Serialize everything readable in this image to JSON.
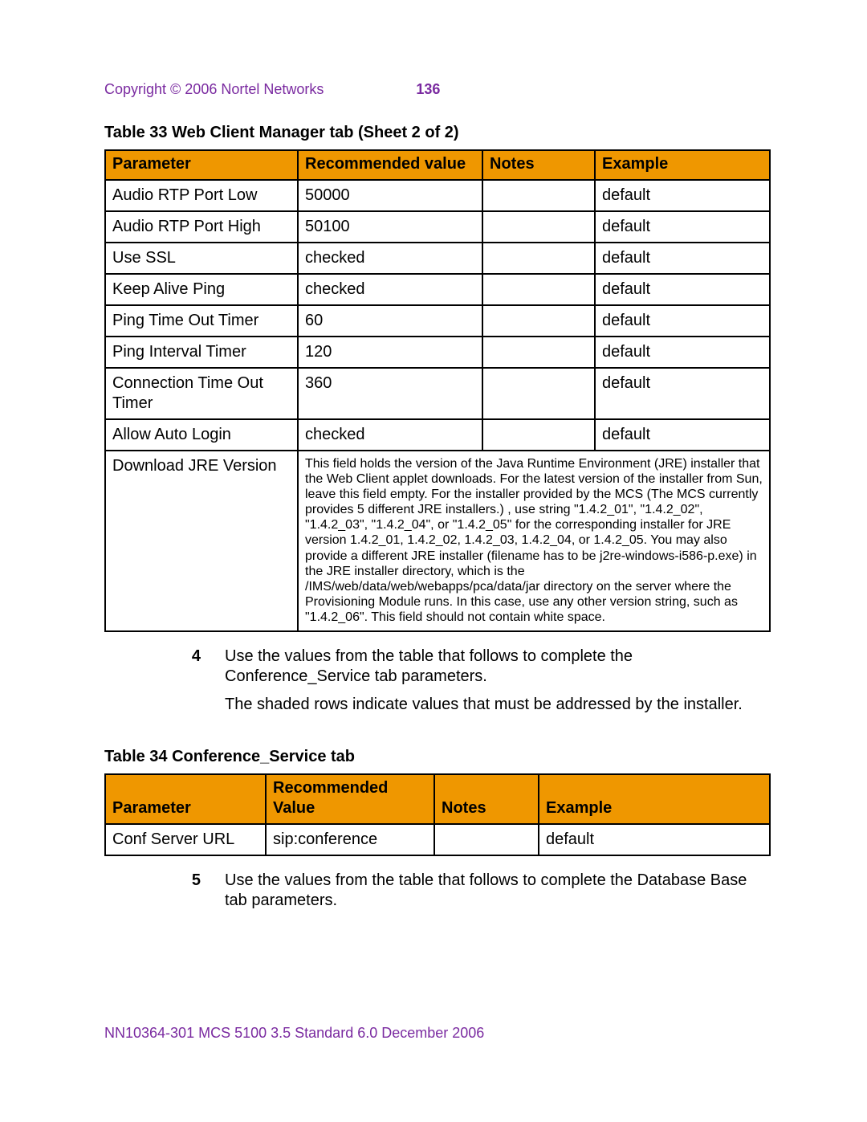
{
  "header": {
    "copyright": "Copyright © 2006 Nortel Networks",
    "page_number": "136"
  },
  "table33": {
    "title": "Table 33  Web Client Manager tab (Sheet 2 of 2)",
    "headers": {
      "parameter": "Parameter",
      "recommended": "Recommended value",
      "notes": "Notes",
      "example": "Example"
    },
    "rows": [
      {
        "parameter": "Audio RTP Port Low",
        "recommended": "50000",
        "notes": "",
        "example": "default"
      },
      {
        "parameter": "Audio RTP Port High",
        "recommended": "50100",
        "notes": "",
        "example": "default"
      },
      {
        "parameter": "Use SSL",
        "recommended": "checked",
        "notes": "",
        "example": "default"
      },
      {
        "parameter": "Keep Alive Ping",
        "recommended": "checked",
        "notes": "",
        "example": "default"
      },
      {
        "parameter": "Ping Time Out Timer",
        "recommended": "60",
        "notes": "",
        "example": "default"
      },
      {
        "parameter": "Ping Interval Timer",
        "recommended": "120",
        "notes": "",
        "example": "default"
      },
      {
        "parameter": "Connection Time Out Timer",
        "recommended": "360",
        "notes": "",
        "example": "default"
      },
      {
        "parameter": "Allow Auto Login",
        "recommended": "checked",
        "notes": "",
        "example": "default"
      }
    ],
    "jre_row": {
      "parameter": "Download JRE Version",
      "note": "This field holds the version of the Java Runtime Environment (JRE) installer that the Web Client applet downloads. For the latest version of the installer from Sun, leave this field empty. For the installer provided by the MCS (The MCS currently provides 5 different JRE installers.) , use string \"1.4.2_01\", \"1.4.2_02\", \"1.4.2_03\", \"1.4.2_04\", or \"1.4.2_05\" for the corresponding installer for JRE version 1.4.2_01, 1.4.2_02, 1.4.2_03, 1.4.2_04, or 1.4.2_05. You may also provide a different JRE installer (filename has to be j2re-windows-i586-p.exe) in the JRE installer directory, which is the /IMS/web/data/web/webapps/pca/data/jar directory on the server where the Provisioning Module runs. In this case, use any other version string, such as \"1.4.2_06\". This field should not contain white space."
    }
  },
  "step4": {
    "number": "4",
    "p1": "Use the values from the table that follows to complete the Conference_Service tab parameters.",
    "p2": "The shaded rows indicate values that must be addressed by the installer."
  },
  "table34": {
    "title": "Table 34  Conference_Service tab",
    "headers": {
      "parameter": "Parameter",
      "recommended": "Recommended Value",
      "notes": "Notes",
      "example": "Example"
    },
    "rows": [
      {
        "parameter": "Conf Server URL",
        "recommended": "sip:conference",
        "notes": "",
        "example": "default"
      }
    ]
  },
  "step5": {
    "number": "5",
    "p1": "Use the values from the table that follows to complete the Database Base tab parameters."
  },
  "footer": {
    "text": "NN10364-301   MCS 5100 3.5   Standard   6.0   December 2006"
  }
}
